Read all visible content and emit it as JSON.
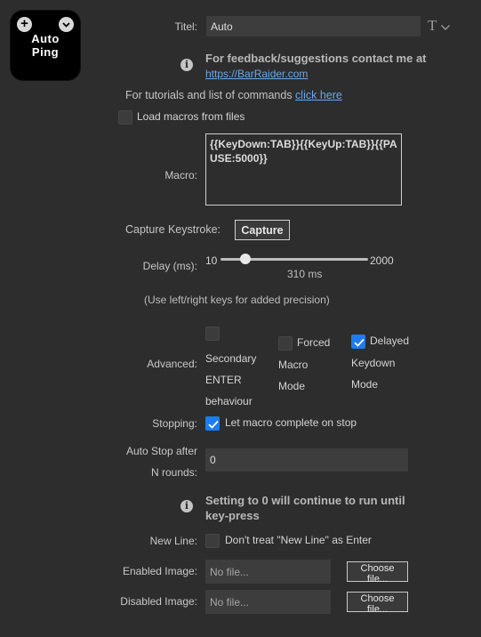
{
  "key_tile": {
    "line1": "Auto",
    "line2": "Ping",
    "plus_glyph": "+",
    "chevron_glyph": "⌄"
  },
  "title_field": {
    "label": "Titel:",
    "value": "Auto",
    "t_glyph": "T",
    "chevron_glyph": "⌄"
  },
  "feedback": {
    "info_glyph": "i",
    "text": "For feedback/suggestions contact me at",
    "link": "https://BarRaider.com"
  },
  "tutorials": {
    "text": "For tutorials and list of commands ",
    "link": "click here"
  },
  "load_macros": {
    "label": "Load macros from files",
    "checked": false
  },
  "macro": {
    "label": "Macro:",
    "value": "{{KeyDown:TAB}}{{KeyUp:TAB}}{{PAUSE:5000}}"
  },
  "capture": {
    "label": "Capture Keystroke:",
    "button": "Capture"
  },
  "delay": {
    "label": "Delay (ms):",
    "min": "10",
    "max": "2000",
    "value_text": "310 ms",
    "value_fraction": 0.151,
    "hint": "(Use left/right keys for added precision)"
  },
  "advanced": {
    "label": "Advanced:",
    "options": [
      {
        "lines": [
          "Secondary",
          "ENTER",
          "behaviour"
        ],
        "checked": false
      },
      {
        "lines": [
          "Forced",
          "Macro",
          "Mode"
        ],
        "checked": false
      },
      {
        "lines": [
          "Delayed",
          "Keydown",
          "Mode"
        ],
        "checked": true
      }
    ]
  },
  "stopping": {
    "label": "Stopping:",
    "option": "Let macro complete on stop",
    "checked": true
  },
  "auto_stop": {
    "label_line1": "Auto Stop after",
    "label_line2": "N rounds:",
    "value": "0"
  },
  "auto_stop_note": {
    "info_glyph": "i",
    "text": "Setting to 0 will continue to run until key-press"
  },
  "new_line": {
    "label": "New Line:",
    "option": "Don't treat \"New Line\" as Enter",
    "checked": false
  },
  "enabled_image": {
    "label": "Enabled Image:",
    "placeholder": "No file...",
    "button": "Choose file..."
  },
  "disabled_image": {
    "label": "Disabled Image:",
    "placeholder": "No file...",
    "button": "Choose file..."
  },
  "colors": {
    "background": "#2d2d2d",
    "accent": "#1e7cf2",
    "link": "#6aa7ea"
  }
}
